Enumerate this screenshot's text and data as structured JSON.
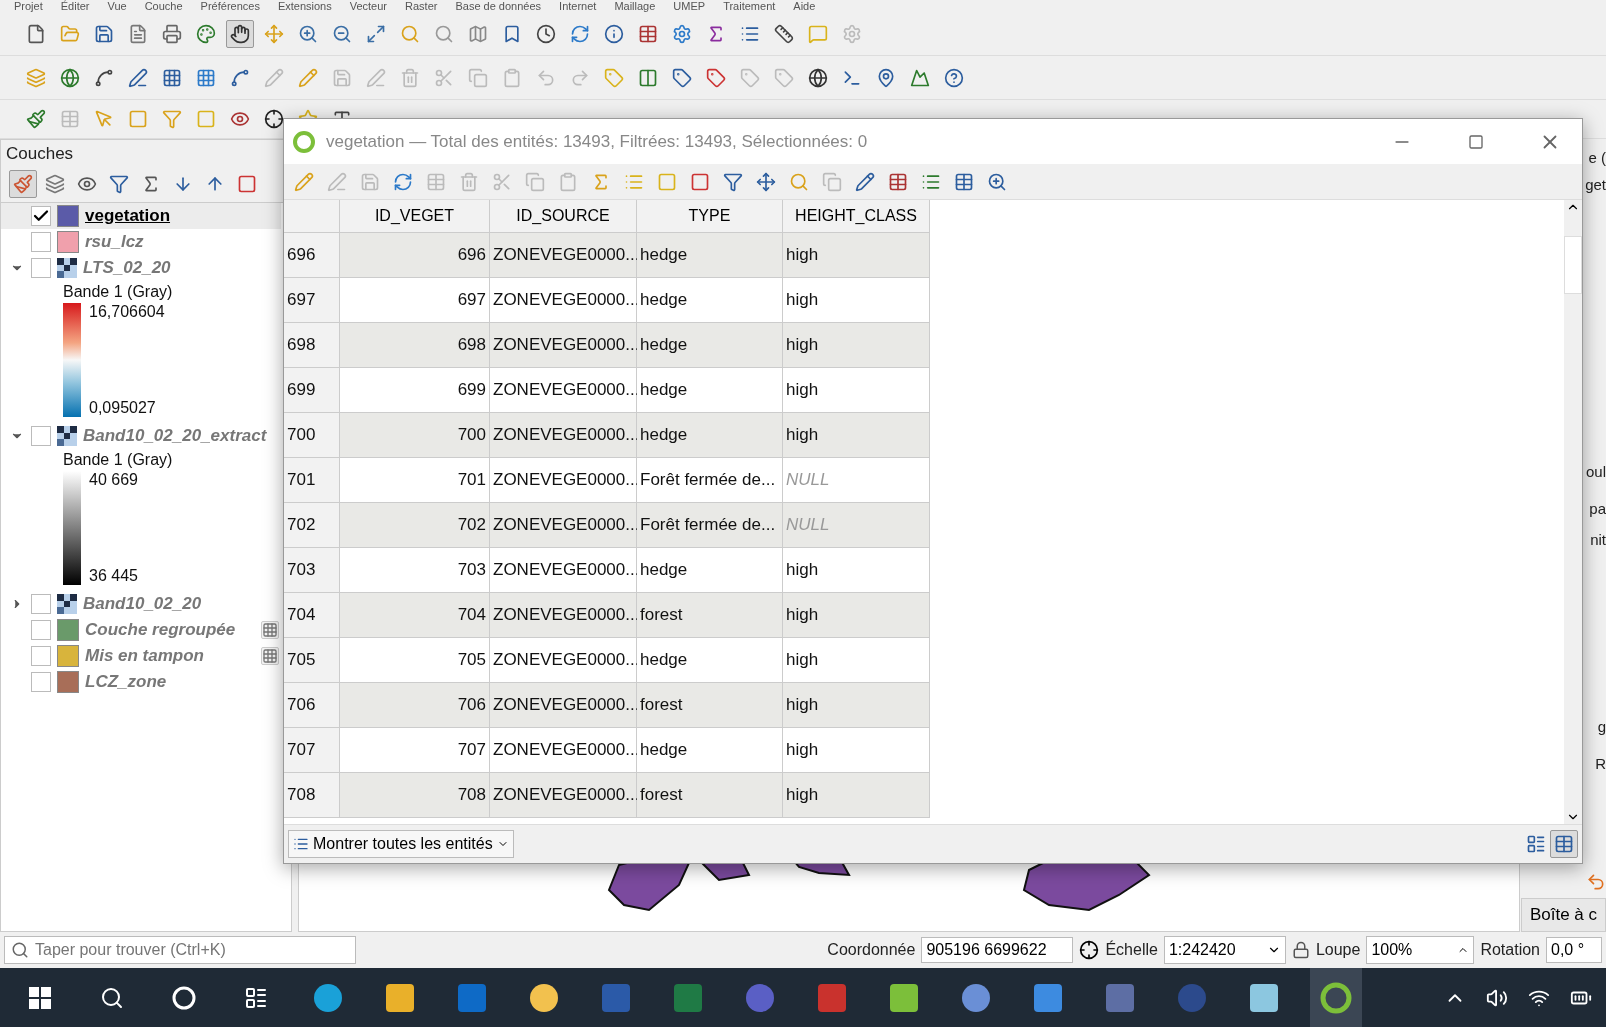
{
  "menu": [
    "Projet",
    "Éditer",
    "Vue",
    "Couche",
    "Préférences",
    "Extensions",
    "Vecteur",
    "Raster",
    "Base de données",
    "Internet",
    "Maillage",
    "UMEP",
    "Traitement",
    "Aide"
  ],
  "layers_panel": {
    "title": "Couches",
    "layers": [
      {
        "name": "vegetation",
        "kind": "vector",
        "checked": true,
        "selected": true,
        "color": "#5b5ba8"
      },
      {
        "name": "rsu_lcz",
        "kind": "vector",
        "checked": false,
        "selected": false,
        "color": "#f0a0ac"
      },
      {
        "name": "LTS_02_20",
        "kind": "raster",
        "checked": false,
        "selected": false,
        "expanded": true,
        "legend": {
          "band": "Bande 1 (Gray)",
          "max": "16,706604",
          "min": "0,095027",
          "kind": "spectral"
        }
      },
      {
        "name": "Band10_02_20_extract",
        "kind": "raster",
        "checked": false,
        "selected": false,
        "expanded": true,
        "legend": {
          "band": "Bande 1 (Gray)",
          "max": "40 669",
          "min": "36 445",
          "kind": "gray"
        }
      },
      {
        "name": "Band10_02_20",
        "kind": "raster",
        "checked": false,
        "selected": false,
        "expanded": false
      },
      {
        "name": "Couche regroupée",
        "kind": "vector",
        "checked": false,
        "selected": false,
        "color": "#6a9a6a",
        "temporary": true
      },
      {
        "name": "Mis en tampon",
        "kind": "vector",
        "checked": false,
        "selected": false,
        "color": "#d8b43c",
        "temporary": true
      },
      {
        "name": "LCZ_zone",
        "kind": "vector",
        "checked": false,
        "selected": false,
        "color": "#a86e58"
      }
    ]
  },
  "attribute_table": {
    "title": "vegetation — Total des entités: 13493, Filtrées: 13493, Sélectionnées: 0",
    "columns": [
      "ID_VEGET",
      "ID_SOURCE",
      "TYPE",
      "HEIGHT_CLASS"
    ],
    "rows": [
      {
        "row": "696",
        "id_veget": "696",
        "id_source": "ZONEVEGE0000...",
        "type": "hedge",
        "height_class": "high",
        "is_null": false
      },
      {
        "row": "697",
        "id_veget": "697",
        "id_source": "ZONEVEGE0000...",
        "type": "hedge",
        "height_class": "high",
        "is_null": false
      },
      {
        "row": "698",
        "id_veget": "698",
        "id_source": "ZONEVEGE0000...",
        "type": "hedge",
        "height_class": "high",
        "is_null": false
      },
      {
        "row": "699",
        "id_veget": "699",
        "id_source": "ZONEVEGE0000...",
        "type": "hedge",
        "height_class": "high",
        "is_null": false
      },
      {
        "row": "700",
        "id_veget": "700",
        "id_source": "ZONEVEGE0000...",
        "type": "hedge",
        "height_class": "high",
        "is_null": false
      },
      {
        "row": "701",
        "id_veget": "701",
        "id_source": "ZONEVEGE0000...",
        "type": "Forêt fermée de...",
        "height_class": "NULL",
        "is_null": true
      },
      {
        "row": "702",
        "id_veget": "702",
        "id_source": "ZONEVEGE0000...",
        "type": "Forêt fermée de...",
        "height_class": "NULL",
        "is_null": true
      },
      {
        "row": "703",
        "id_veget": "703",
        "id_source": "ZONEVEGE0000...",
        "type": "hedge",
        "height_class": "high",
        "is_null": false
      },
      {
        "row": "704",
        "id_veget": "704",
        "id_source": "ZONEVEGE0000...",
        "type": "forest",
        "height_class": "high",
        "is_null": false
      },
      {
        "row": "705",
        "id_veget": "705",
        "id_source": "ZONEVEGE0000...",
        "type": "hedge",
        "height_class": "high",
        "is_null": false
      },
      {
        "row": "706",
        "id_veget": "706",
        "id_source": "ZONEVEGE0000...",
        "type": "forest",
        "height_class": "high",
        "is_null": false
      },
      {
        "row": "707",
        "id_veget": "707",
        "id_source": "ZONEVEGE0000...",
        "type": "hedge",
        "height_class": "high",
        "is_null": false
      },
      {
        "row": "708",
        "id_veget": "708",
        "id_source": "ZONEVEGE0000...",
        "type": "forest",
        "height_class": "high",
        "is_null": false
      }
    ],
    "footer_button": "Montrer toutes les entités"
  },
  "right_panel": {
    "texts": [
      "e (",
      "get",
      "oul",
      "pa",
      "nit",
      "g",
      "R"
    ],
    "button": "Boîte à c"
  },
  "status_bar": {
    "search_placeholder": "Taper pour trouver (Ctrl+K)",
    "coordinate_label": "Coordonnée",
    "coordinate": "905196 6699622",
    "scale_label": "Échelle",
    "scale": "1:242420",
    "magnifier_label": "Loupe",
    "magnifier": "100%",
    "rotation_label": "Rotation",
    "rotation": "0,0 °"
  }
}
